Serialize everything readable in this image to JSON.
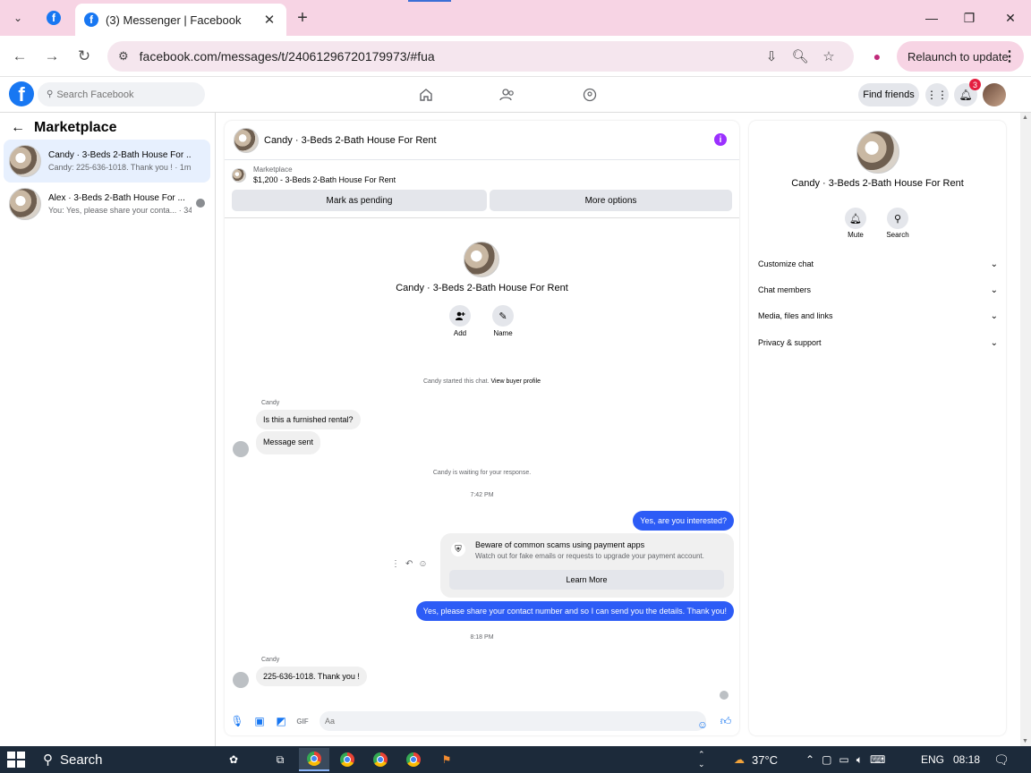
{
  "browser": {
    "tab_title": "(3) Messenger | Facebook",
    "url": "facebook.com/messages/t/24061296720179973/#fua",
    "relaunch_label": "Relaunch to update"
  },
  "fb": {
    "search_placeholder": "Search Facebook",
    "find_friends": "Find friends",
    "notif_count": "3"
  },
  "sidebar": {
    "title": "Marketplace",
    "conversations": [
      {
        "name": "Candy · 3-Beds 2-Bath House For ...",
        "snippet": "Candy: 225-636-1018. Thank you ! · 1m"
      },
      {
        "name": "Alex · 3-Beds 2-Bath House For ...",
        "snippet": "You: Yes, please share your conta... · 34m"
      }
    ]
  },
  "chat": {
    "header_name": "Candy · 3-Beds 2-Bath House For Rent",
    "marketplace_label": "Marketplace",
    "listing": "$1,200 - 3-Beds 2-Bath House For Rent",
    "mark_pending": "Mark as pending",
    "more_options": "More options",
    "center_name": "Candy · 3-Beds 2-Bath House For Rent",
    "add_label": "Add",
    "name_label": "Name",
    "started_text": "Candy started this chat.",
    "view_profile": "View buyer profile",
    "sender1": "Candy",
    "msg1": "Is this a furnished rental?",
    "msg2": "Message sent",
    "waiting_text": "Candy is waiting for your response.",
    "time1": "7:42 PM",
    "out1": "Yes, are you interested?",
    "scam_title": "Beware of common scams using payment apps",
    "scam_sub": "Watch out for fake emails or requests to upgrade your payment account.",
    "learn_more": "Learn More",
    "out2": "Yes, please share your contact number and so I can send you the details. Thank you!",
    "time2": "8:18 PM",
    "sender2": "Candy",
    "msg3": "225-636-1018. Thank you !",
    "composer_placeholder": "Aa"
  },
  "right_panel": {
    "name": "Candy · 3-Beds 2-Bath House For Rent",
    "mute": "Mute",
    "search": "Search",
    "rows": [
      "Customize chat",
      "Chat members",
      "Media, files and links",
      "Privacy & support"
    ]
  },
  "taskbar": {
    "search_label": "Search",
    "temperature": "37°C",
    "language": "ENG",
    "time": "08:18"
  },
  "colors": {
    "fb_blue": "#1877f2",
    "outgoing_bubble": "#2d5cf6",
    "tab_strip": "#f7d4e4"
  }
}
